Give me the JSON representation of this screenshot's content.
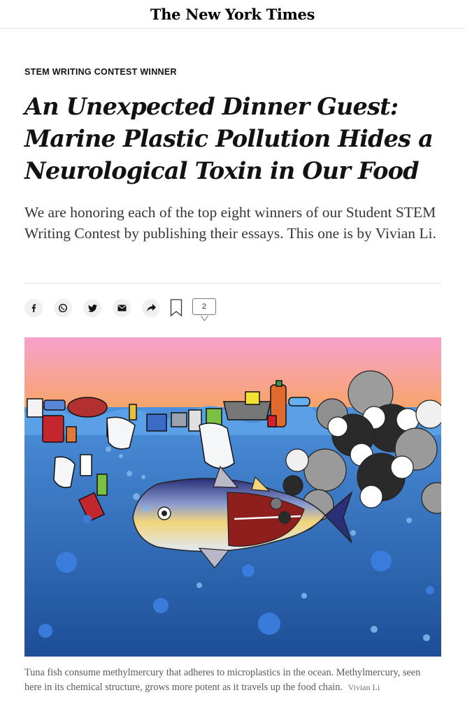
{
  "masthead": {
    "logo": "The New York Times"
  },
  "article": {
    "kicker": "STEM WRITING CONTEST WINNER",
    "headline": "An Unexpected Dinner Guest: Marine Plastic Pollution Hides a Neurological Toxin in Our Food",
    "summary": "We are honoring each of the top eight winners of our Student STEM Writing Contest by publishing their essays. This one is by Vivian Li."
  },
  "share_bar": {
    "icons": [
      "facebook-icon",
      "whatsapp-icon",
      "twitter-icon",
      "email-icon",
      "share-icon",
      "bookmark-icon",
      "comment-icon"
    ],
    "comment_count": "2"
  },
  "figure": {
    "caption": "Tuna fish consume methylmercury that adheres to microplastics in the ocean. Methylmercury, seen here in its chemical structure, grows more potent as it travels up the food chain.",
    "credit": "Vivian Li"
  },
  "colors": {
    "sky_top": "#f4a6c8",
    "sky_bottom": "#f8a35a",
    "ocean_top": "#4f8fd8",
    "ocean_bottom": "#1e4f96",
    "text": "#121212",
    "caption": "#5a5a5a"
  }
}
